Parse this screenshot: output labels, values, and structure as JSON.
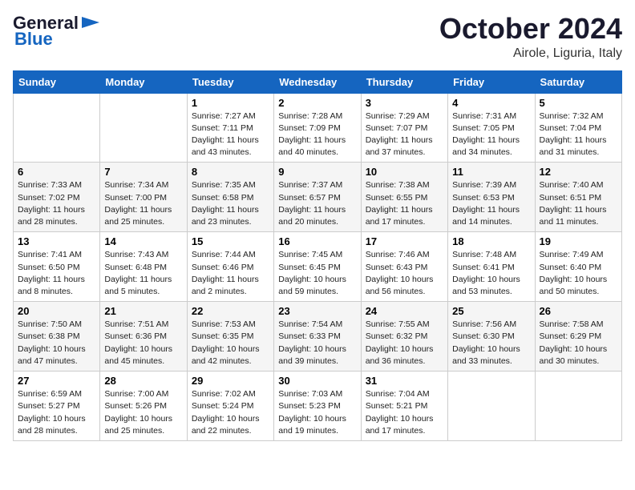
{
  "header": {
    "logo_general": "General",
    "logo_blue": "Blue",
    "month": "October 2024",
    "location": "Airole, Liguria, Italy"
  },
  "days_of_week": [
    "Sunday",
    "Monday",
    "Tuesday",
    "Wednesday",
    "Thursday",
    "Friday",
    "Saturday"
  ],
  "weeks": [
    [
      null,
      null,
      {
        "day": "1",
        "sunrise": "7:27 AM",
        "sunset": "7:11 PM",
        "daylight": "11 hours and 43 minutes."
      },
      {
        "day": "2",
        "sunrise": "7:28 AM",
        "sunset": "7:09 PM",
        "daylight": "11 hours and 40 minutes."
      },
      {
        "day": "3",
        "sunrise": "7:29 AM",
        "sunset": "7:07 PM",
        "daylight": "11 hours and 37 minutes."
      },
      {
        "day": "4",
        "sunrise": "7:31 AM",
        "sunset": "7:05 PM",
        "daylight": "11 hours and 34 minutes."
      },
      {
        "day": "5",
        "sunrise": "7:32 AM",
        "sunset": "7:04 PM",
        "daylight": "11 hours and 31 minutes."
      }
    ],
    [
      {
        "day": "6",
        "sunrise": "7:33 AM",
        "sunset": "7:02 PM",
        "daylight": "11 hours and 28 minutes."
      },
      {
        "day": "7",
        "sunrise": "7:34 AM",
        "sunset": "7:00 PM",
        "daylight": "11 hours and 25 minutes."
      },
      {
        "day": "8",
        "sunrise": "7:35 AM",
        "sunset": "6:58 PM",
        "daylight": "11 hours and 23 minutes."
      },
      {
        "day": "9",
        "sunrise": "7:37 AM",
        "sunset": "6:57 PM",
        "daylight": "11 hours and 20 minutes."
      },
      {
        "day": "10",
        "sunrise": "7:38 AM",
        "sunset": "6:55 PM",
        "daylight": "11 hours and 17 minutes."
      },
      {
        "day": "11",
        "sunrise": "7:39 AM",
        "sunset": "6:53 PM",
        "daylight": "11 hours and 14 minutes."
      },
      {
        "day": "12",
        "sunrise": "7:40 AM",
        "sunset": "6:51 PM",
        "daylight": "11 hours and 11 minutes."
      }
    ],
    [
      {
        "day": "13",
        "sunrise": "7:41 AM",
        "sunset": "6:50 PM",
        "daylight": "11 hours and 8 minutes."
      },
      {
        "day": "14",
        "sunrise": "7:43 AM",
        "sunset": "6:48 PM",
        "daylight": "11 hours and 5 minutes."
      },
      {
        "day": "15",
        "sunrise": "7:44 AM",
        "sunset": "6:46 PM",
        "daylight": "11 hours and 2 minutes."
      },
      {
        "day": "16",
        "sunrise": "7:45 AM",
        "sunset": "6:45 PM",
        "daylight": "10 hours and 59 minutes."
      },
      {
        "day": "17",
        "sunrise": "7:46 AM",
        "sunset": "6:43 PM",
        "daylight": "10 hours and 56 minutes."
      },
      {
        "day": "18",
        "sunrise": "7:48 AM",
        "sunset": "6:41 PM",
        "daylight": "10 hours and 53 minutes."
      },
      {
        "day": "19",
        "sunrise": "7:49 AM",
        "sunset": "6:40 PM",
        "daylight": "10 hours and 50 minutes."
      }
    ],
    [
      {
        "day": "20",
        "sunrise": "7:50 AM",
        "sunset": "6:38 PM",
        "daylight": "10 hours and 47 minutes."
      },
      {
        "day": "21",
        "sunrise": "7:51 AM",
        "sunset": "6:36 PM",
        "daylight": "10 hours and 45 minutes."
      },
      {
        "day": "22",
        "sunrise": "7:53 AM",
        "sunset": "6:35 PM",
        "daylight": "10 hours and 42 minutes."
      },
      {
        "day": "23",
        "sunrise": "7:54 AM",
        "sunset": "6:33 PM",
        "daylight": "10 hours and 39 minutes."
      },
      {
        "day": "24",
        "sunrise": "7:55 AM",
        "sunset": "6:32 PM",
        "daylight": "10 hours and 36 minutes."
      },
      {
        "day": "25",
        "sunrise": "7:56 AM",
        "sunset": "6:30 PM",
        "daylight": "10 hours and 33 minutes."
      },
      {
        "day": "26",
        "sunrise": "7:58 AM",
        "sunset": "6:29 PM",
        "daylight": "10 hours and 30 minutes."
      }
    ],
    [
      {
        "day": "27",
        "sunrise": "6:59 AM",
        "sunset": "5:27 PM",
        "daylight": "10 hours and 28 minutes."
      },
      {
        "day": "28",
        "sunrise": "7:00 AM",
        "sunset": "5:26 PM",
        "daylight": "10 hours and 25 minutes."
      },
      {
        "day": "29",
        "sunrise": "7:02 AM",
        "sunset": "5:24 PM",
        "daylight": "10 hours and 22 minutes."
      },
      {
        "day": "30",
        "sunrise": "7:03 AM",
        "sunset": "5:23 PM",
        "daylight": "10 hours and 19 minutes."
      },
      {
        "day": "31",
        "sunrise": "7:04 AM",
        "sunset": "5:21 PM",
        "daylight": "10 hours and 17 minutes."
      },
      null,
      null
    ]
  ]
}
